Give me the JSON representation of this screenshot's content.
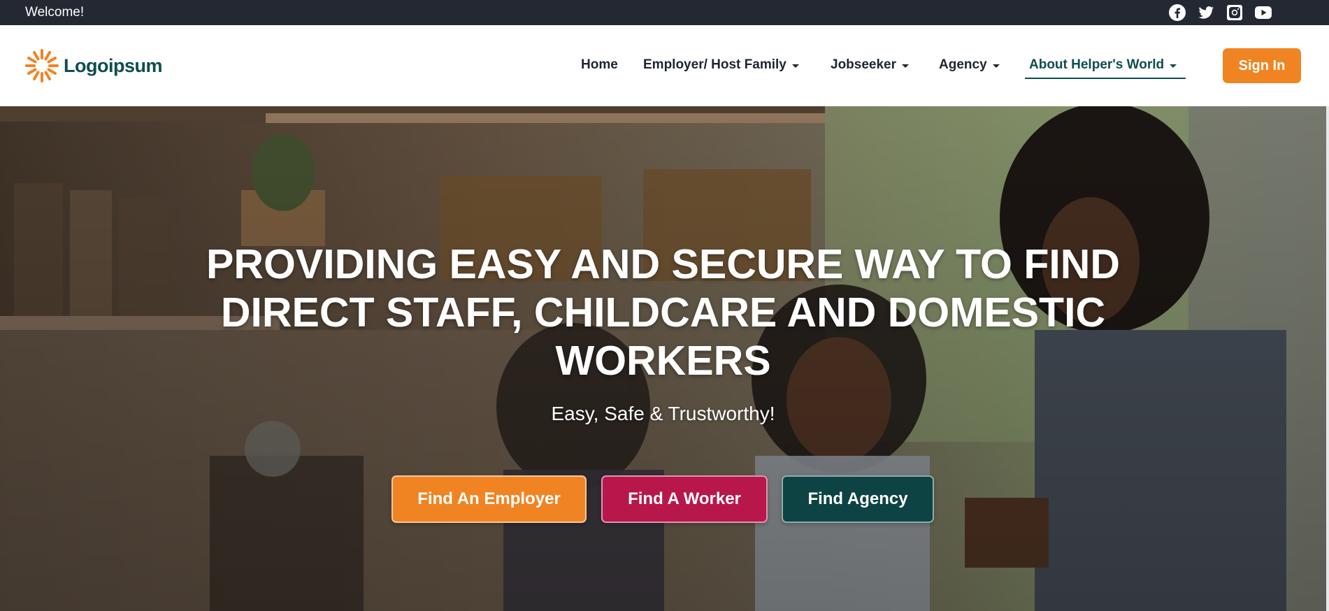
{
  "topbar": {
    "welcome": "Welcome!",
    "social_icons": [
      "facebook-icon",
      "twitter-icon",
      "instagram-icon",
      "youtube-icon"
    ]
  },
  "header": {
    "logo_text": "Logoipsum",
    "nav": [
      {
        "label": "Home",
        "dropdown": false
      },
      {
        "label": "Employer/ Host Family",
        "dropdown": true
      },
      {
        "label": "Jobseeker",
        "dropdown": true
      },
      {
        "label": "Agency",
        "dropdown": true
      },
      {
        "label": "About Helper's World",
        "dropdown": true,
        "active": true
      }
    ],
    "signin_label": "Sign In"
  },
  "hero": {
    "title_line1": "PROVIDING EASY AND SECURE WAY TO FIND",
    "title_line2": "DIRECT STAFF, CHILDCARE AND DOMESTIC",
    "title_line3": "WORKERS",
    "subtitle": "Easy, Safe & Trustworthy!",
    "buttons": {
      "employer": "Find An Employer",
      "worker": "Find A Worker",
      "agency": "Find Agency"
    }
  },
  "colors": {
    "topbar_bg": "#232833",
    "brand_teal": "#0f4d4f",
    "accent_orange": "#f08423",
    "accent_crimson": "#b8174b",
    "accent_dark_teal": "#0e4344"
  }
}
